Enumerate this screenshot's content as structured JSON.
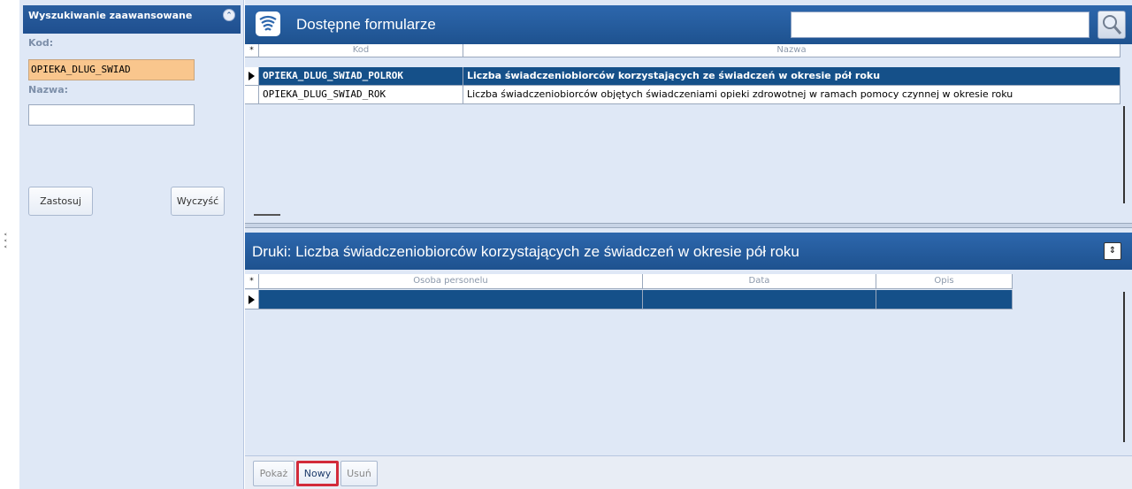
{
  "search_panel": {
    "title": "Wyszukiwanie zaawansowane",
    "kod_label": "Kod:",
    "kod_value": "OPIEKA_DLUG_SWIAD",
    "nazwa_label": "Nazwa:",
    "nazwa_value": "",
    "apply_label": "Zastosuj",
    "clear_label": "Wyczyść"
  },
  "forms": {
    "title": "Dostępne formularze",
    "search_value": "",
    "columns": [
      "Kod",
      "Nazwa"
    ],
    "rows": [
      {
        "kod": "OPIEKA_DLUG_SWIAD_POLROK",
        "nazwa": "Liczba świadczeniobiorców korzystających ze świadczeń w okresie pół roku",
        "selected": true
      },
      {
        "kod": "OPIEKA_DLUG_SWIAD_ROK",
        "nazwa": "Liczba świadczeniobiorców objętych świadczeniami opieki zdrowotnej w ramach pomocy czynnej w okresie roku",
        "selected": false
      }
    ]
  },
  "druki": {
    "title": "Druki: Liczba świadczeniobiorców korzystających ze świadczeń w okresie pół roku",
    "columns": [
      "Osoba personelu",
      "Data",
      "Opis"
    ]
  },
  "bottom": {
    "pokaz_label": "Pokaż",
    "nowy_label": "Nowy",
    "usun_label": "Usuń"
  },
  "colors": {
    "header_blue": "#1e528f",
    "selected_row": "#155089",
    "kod_highlight": "#f9c68d",
    "nowy_outline": "#d22b3a"
  }
}
